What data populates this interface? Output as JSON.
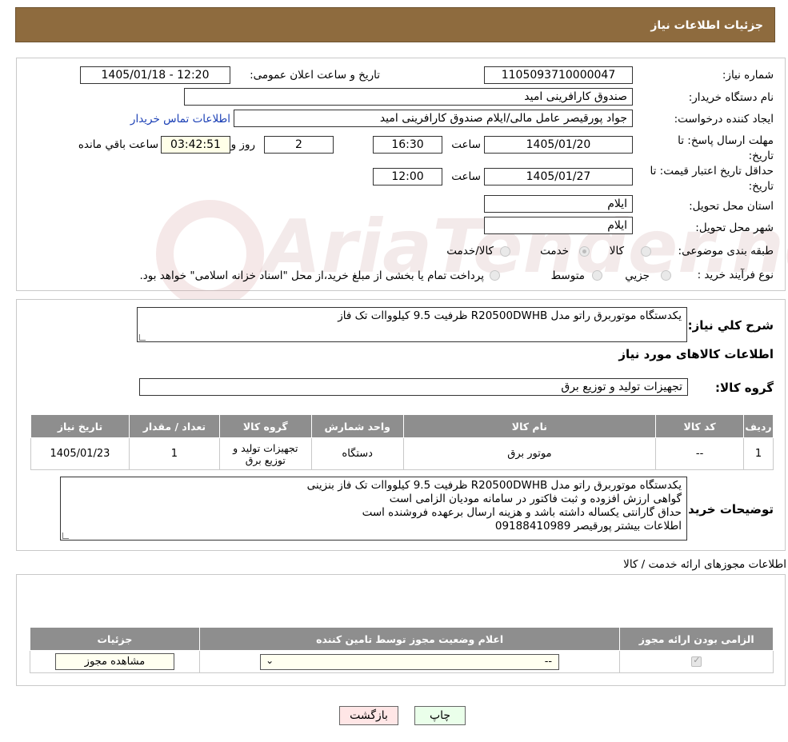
{
  "header": {
    "title": "جزئیات اطلاعات نیاز"
  },
  "form": {
    "need_number_label": "شماره نیاز:",
    "need_number": "1105093710000047",
    "announce_label": "تاریخ و ساعت اعلان عمومی:",
    "announce_value": "1405/01/18 - 12:20",
    "buyer_org_label": "نام دستگاه خریدار:",
    "buyer_org": "صندوق کارافرینی امید",
    "requester_label": "ایجاد کننده درخواست:",
    "requester": "جواد پورقیصر عامل مالی/ایلام صندوق کارافرینی امید",
    "contact_link": "اطلاعات تماس خریدار",
    "reply_deadline_label": "مهلت ارسال پاسخ: تا تاریخ:",
    "reply_date": "1405/01/20",
    "time_label": "ساعت",
    "reply_time": "16:30",
    "days_value": "2",
    "days_label": "روز و",
    "remaining_value": "03:42:51",
    "remaining_label": "ساعت باقي مانده",
    "price_validity_label": "حداقل تاریخ اعتبار قیمت: تا تاریخ:",
    "price_date": "1405/01/27",
    "price_time": "12:00",
    "province_label": "استان محل تحویل:",
    "province": "ایلام",
    "city_label": "شهر محل تحویل:",
    "city": "ایلام",
    "category_label": "طبقه بندی موضوعی:",
    "category_options": [
      "کالا",
      "خدمت",
      "کالا/خدمت"
    ],
    "purchase_type_label": "نوع فرآیند خرید :",
    "purchase_options": [
      "جزیي",
      "متوسط"
    ],
    "purchase_note": "پرداخت تمام یا بخشی از مبلغ خرید،از محل \"اسناد خزانه اسلامی\" خواهد بود."
  },
  "summary": {
    "label": "شرح کلي نیاز:",
    "text": "یکدستگاه موتوربرق راتو مدل R20500DWHB ظرفیت 9.5 کیلوواات تک فاز",
    "goods_info_title": "اطلاعات کالاهای مورد نیاز",
    "group_label": "گروه کالا:",
    "group_value": "تجهیزات تولید و توزیع برق"
  },
  "goods_table": {
    "headers": [
      "ردیف",
      "کد کالا",
      "نام کالا",
      "واحد شمارش",
      "گروه کالا",
      "تعداد / مقدار",
      "تاریخ نیاز"
    ],
    "rows": [
      [
        "1",
        "--",
        "موتور برق",
        "دستگاه",
        "تجهیزات تولید و توزیع برق",
        "1",
        "1405/01/23"
      ]
    ]
  },
  "buyer_notes": {
    "label": "توضیحات خریدار:",
    "lines": [
      "یکدستگاه موتوربرق راتو مدل R20500DWHB ظرفیت 9.5 کیلوواات تک فاز بنزینی",
      "گواهی ارزش افزوده و ثبت فاکتور در سامانه مودیان الزامی است",
      "حداق گارانتی یکساله داشته باشد و هزینه ارسال برعهده فروشنده است",
      "اطلاعات بیشتر پورقیصر 09188410989"
    ]
  },
  "permits": {
    "title": "اطلاعات مجوزهای ارائه خدمت / کالا",
    "headers": [
      "الزامی بودن ارائه مجوز",
      "اعلام وضعیت مجوز توسط تامین کننده",
      "جزئیات"
    ],
    "select_value": "--",
    "view_button": "مشاهده مجوز"
  },
  "footer": {
    "print_button": "چاپ",
    "back_button": "بازگشت"
  },
  "watermark": {
    "text": "AriaTender.neT"
  }
}
